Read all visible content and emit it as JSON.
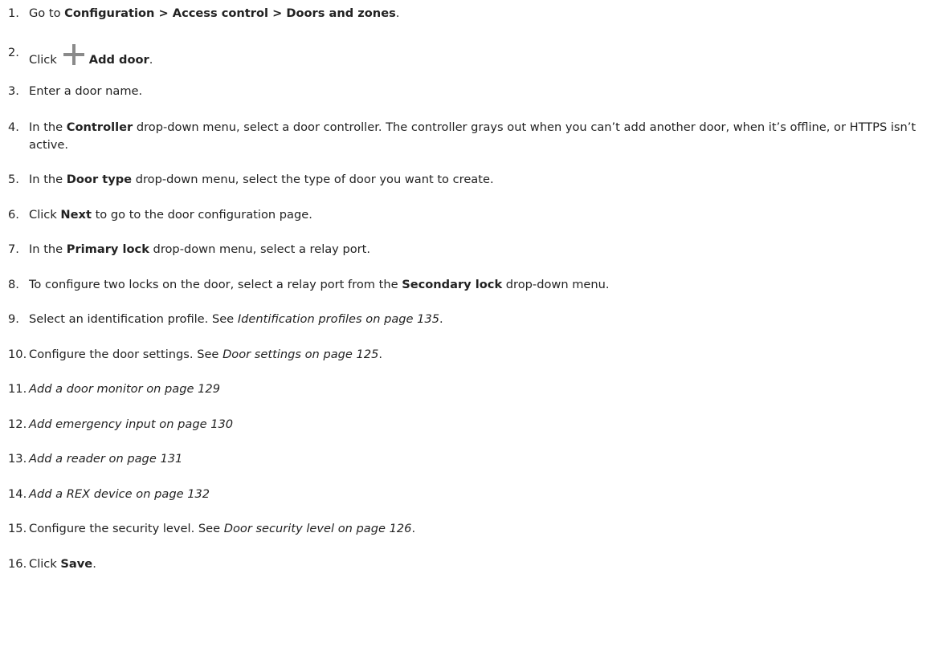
{
  "steps": [
    {
      "n": "1.",
      "parts": [
        {
          "t": "Go to "
        },
        {
          "t": "Configuration > Access control > Doors and zones",
          "b": true
        },
        {
          "t": "."
        }
      ]
    },
    {
      "n": "2.",
      "icon": "plus-icon",
      "parts_before": [
        {
          "t": "Click"
        }
      ],
      "parts": [
        {
          "t": "Add door",
          "b": true
        },
        {
          "t": "."
        }
      ]
    },
    {
      "n": "3.",
      "parts": [
        {
          "t": "Enter a door name."
        }
      ]
    },
    {
      "n": "4.",
      "parts": [
        {
          "t": "In the "
        },
        {
          "t": "Controller",
          "b": true
        },
        {
          "t": " drop-down menu, select a door controller. The controller grays out when you can’t add another door, when it’s offline, or HTTPS isn’t active."
        }
      ]
    },
    {
      "n": "5.",
      "parts": [
        {
          "t": "In the "
        },
        {
          "t": "Door type",
          "b": true
        },
        {
          "t": " drop-down menu, select the type of door you want to create."
        }
      ]
    },
    {
      "n": "6.",
      "parts": [
        {
          "t": "Click "
        },
        {
          "t": "Next",
          "b": true
        },
        {
          "t": " to go to the door configuration page."
        }
      ]
    },
    {
      "n": "7.",
      "parts": [
        {
          "t": "In the "
        },
        {
          "t": "Primary lock",
          "b": true
        },
        {
          "t": " drop-down menu, select a relay port."
        }
      ]
    },
    {
      "n": "8.",
      "parts": [
        {
          "t": "To configure two locks on the door, select a relay port from the "
        },
        {
          "t": "Secondary lock",
          "b": true
        },
        {
          "t": " drop-down menu."
        }
      ]
    },
    {
      "n": "9.",
      "parts": [
        {
          "t": "Select an identification profile. See "
        },
        {
          "t": "Identification profiles on page 135",
          "i": true
        },
        {
          "t": "."
        }
      ]
    },
    {
      "n": "10.",
      "parts": [
        {
          "t": "Configure the door settings. See "
        },
        {
          "t": "Door settings on page 125",
          "i": true
        },
        {
          "t": "."
        }
      ]
    },
    {
      "n": "11.",
      "parts": [
        {
          "t": "Add a door monitor on page 129",
          "i": true
        }
      ]
    },
    {
      "n": "12.",
      "parts": [
        {
          "t": "Add emergency input on page 130",
          "i": true
        }
      ]
    },
    {
      "n": "13.",
      "parts": [
        {
          "t": "Add a reader on page 131",
          "i": true
        }
      ]
    },
    {
      "n": "14.",
      "parts": [
        {
          "t": "Add a REX device on page 132",
          "i": true
        }
      ]
    },
    {
      "n": "15.",
      "parts": [
        {
          "t": "Configure the security level. See "
        },
        {
          "t": "Door security level on page 126",
          "i": true
        },
        {
          "t": "."
        }
      ]
    },
    {
      "n": "16.",
      "parts": [
        {
          "t": "Click "
        },
        {
          "t": "Save",
          "b": true
        },
        {
          "t": "."
        }
      ]
    }
  ]
}
